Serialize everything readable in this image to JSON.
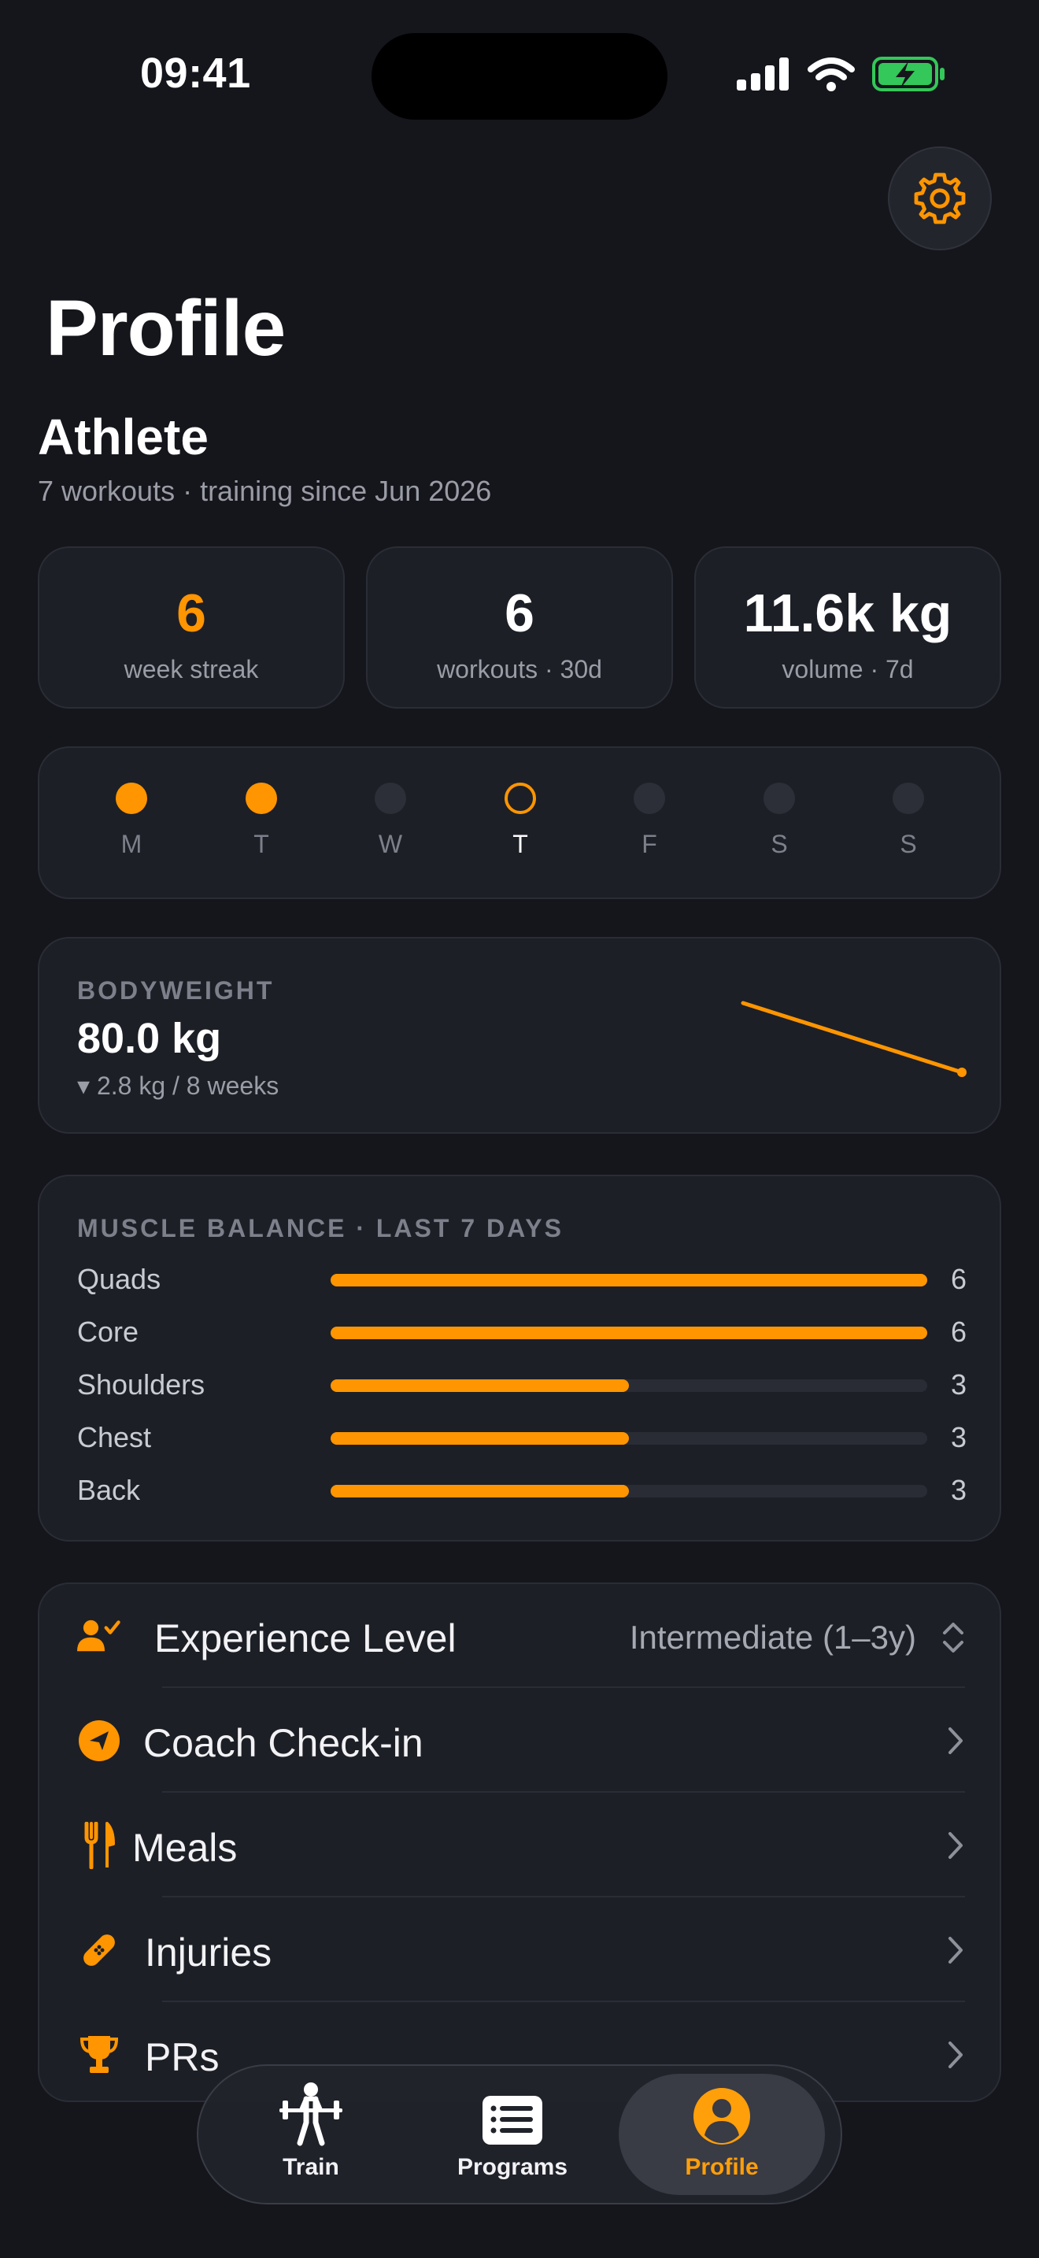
{
  "status_bar": {
    "time": "09:41"
  },
  "header": {
    "title": "Profile"
  },
  "profile": {
    "name": "Athlete",
    "subtitle": "7 workouts · training since Jun 2026"
  },
  "stats": [
    {
      "value": "6",
      "label": "week streak",
      "color": "#ff9500"
    },
    {
      "value": "6",
      "label": "workouts · 30d",
      "color": "#ffffff"
    },
    {
      "value": "11.6k kg",
      "label": "volume · 7d",
      "color": "#ffffff"
    }
  ],
  "week": [
    {
      "label": "M",
      "state": "done"
    },
    {
      "label": "T",
      "state": "done"
    },
    {
      "label": "W",
      "state": "empty"
    },
    {
      "label": "T",
      "state": "today"
    },
    {
      "label": "F",
      "state": "empty"
    },
    {
      "label": "S",
      "state": "empty"
    },
    {
      "label": "S",
      "state": "empty"
    }
  ],
  "bodyweight": {
    "title": "BODYWEIGHT",
    "value": "80.0 kg",
    "delta": "▾ 2.8 kg / 8 weeks"
  },
  "muscle_balance": {
    "title": "MUSCLE BALANCE · LAST 7 DAYS",
    "max": 6,
    "rows": [
      {
        "name": "Quads",
        "value": 6
      },
      {
        "name": "Core",
        "value": 6
      },
      {
        "name": "Shoulders",
        "value": 3
      },
      {
        "name": "Chest",
        "value": 3
      },
      {
        "name": "Back",
        "value": 3
      }
    ]
  },
  "settings_list": {
    "experience_label": "Experience Level",
    "experience_value": "Intermediate (1–3y)",
    "coach_label": "Coach Check-in",
    "meals_label": "Meals",
    "injuries_label": "Injuries",
    "prs_label": "PRs"
  },
  "tabbar": {
    "train": "Train",
    "programs": "Programs",
    "profile": "Profile"
  },
  "colors": {
    "accent": "#ff9500",
    "background": "#15161c",
    "card": "#1d1f27"
  }
}
